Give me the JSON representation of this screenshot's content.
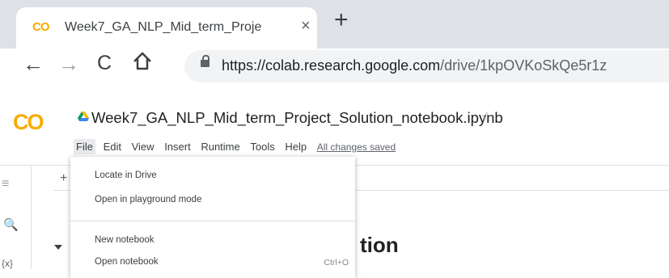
{
  "tab": {
    "favicon": "CO",
    "title": "Week7_GA_NLP_Mid_term_Proje",
    "close": "×",
    "new_tab": "+"
  },
  "toolbar": {
    "back": "←",
    "forward": "→",
    "reload": "C",
    "url_host": "https://colab.research.google.com",
    "url_path": "/drive/1kpOVKoSkQe5r1z"
  },
  "colab": {
    "logo": "CO",
    "notebook_title": "Week7_GA_NLP_Mid_term_Project_Solution_notebook.ipynb",
    "star": "☆",
    "menu": [
      "File",
      "Edit",
      "View",
      "Insert",
      "Runtime",
      "Tools",
      "Help"
    ],
    "save_status": "All changes saved",
    "add_code": "+",
    "heading_fragment": "tion"
  },
  "sidebar": {
    "toc_icon": "≡",
    "search_icon": "🔍",
    "vars_icon": "{x}"
  },
  "file_menu": {
    "items": [
      "Locate in Drive",
      "Open in playground mode",
      "New notebook",
      "Open notebook"
    ],
    "open_shortcut": "Ctrl+O"
  },
  "colors": {
    "colab_orange": "#f9ab00",
    "colab_dark_orange": "#e8710a",
    "tabstrip": "#dee1e6"
  }
}
